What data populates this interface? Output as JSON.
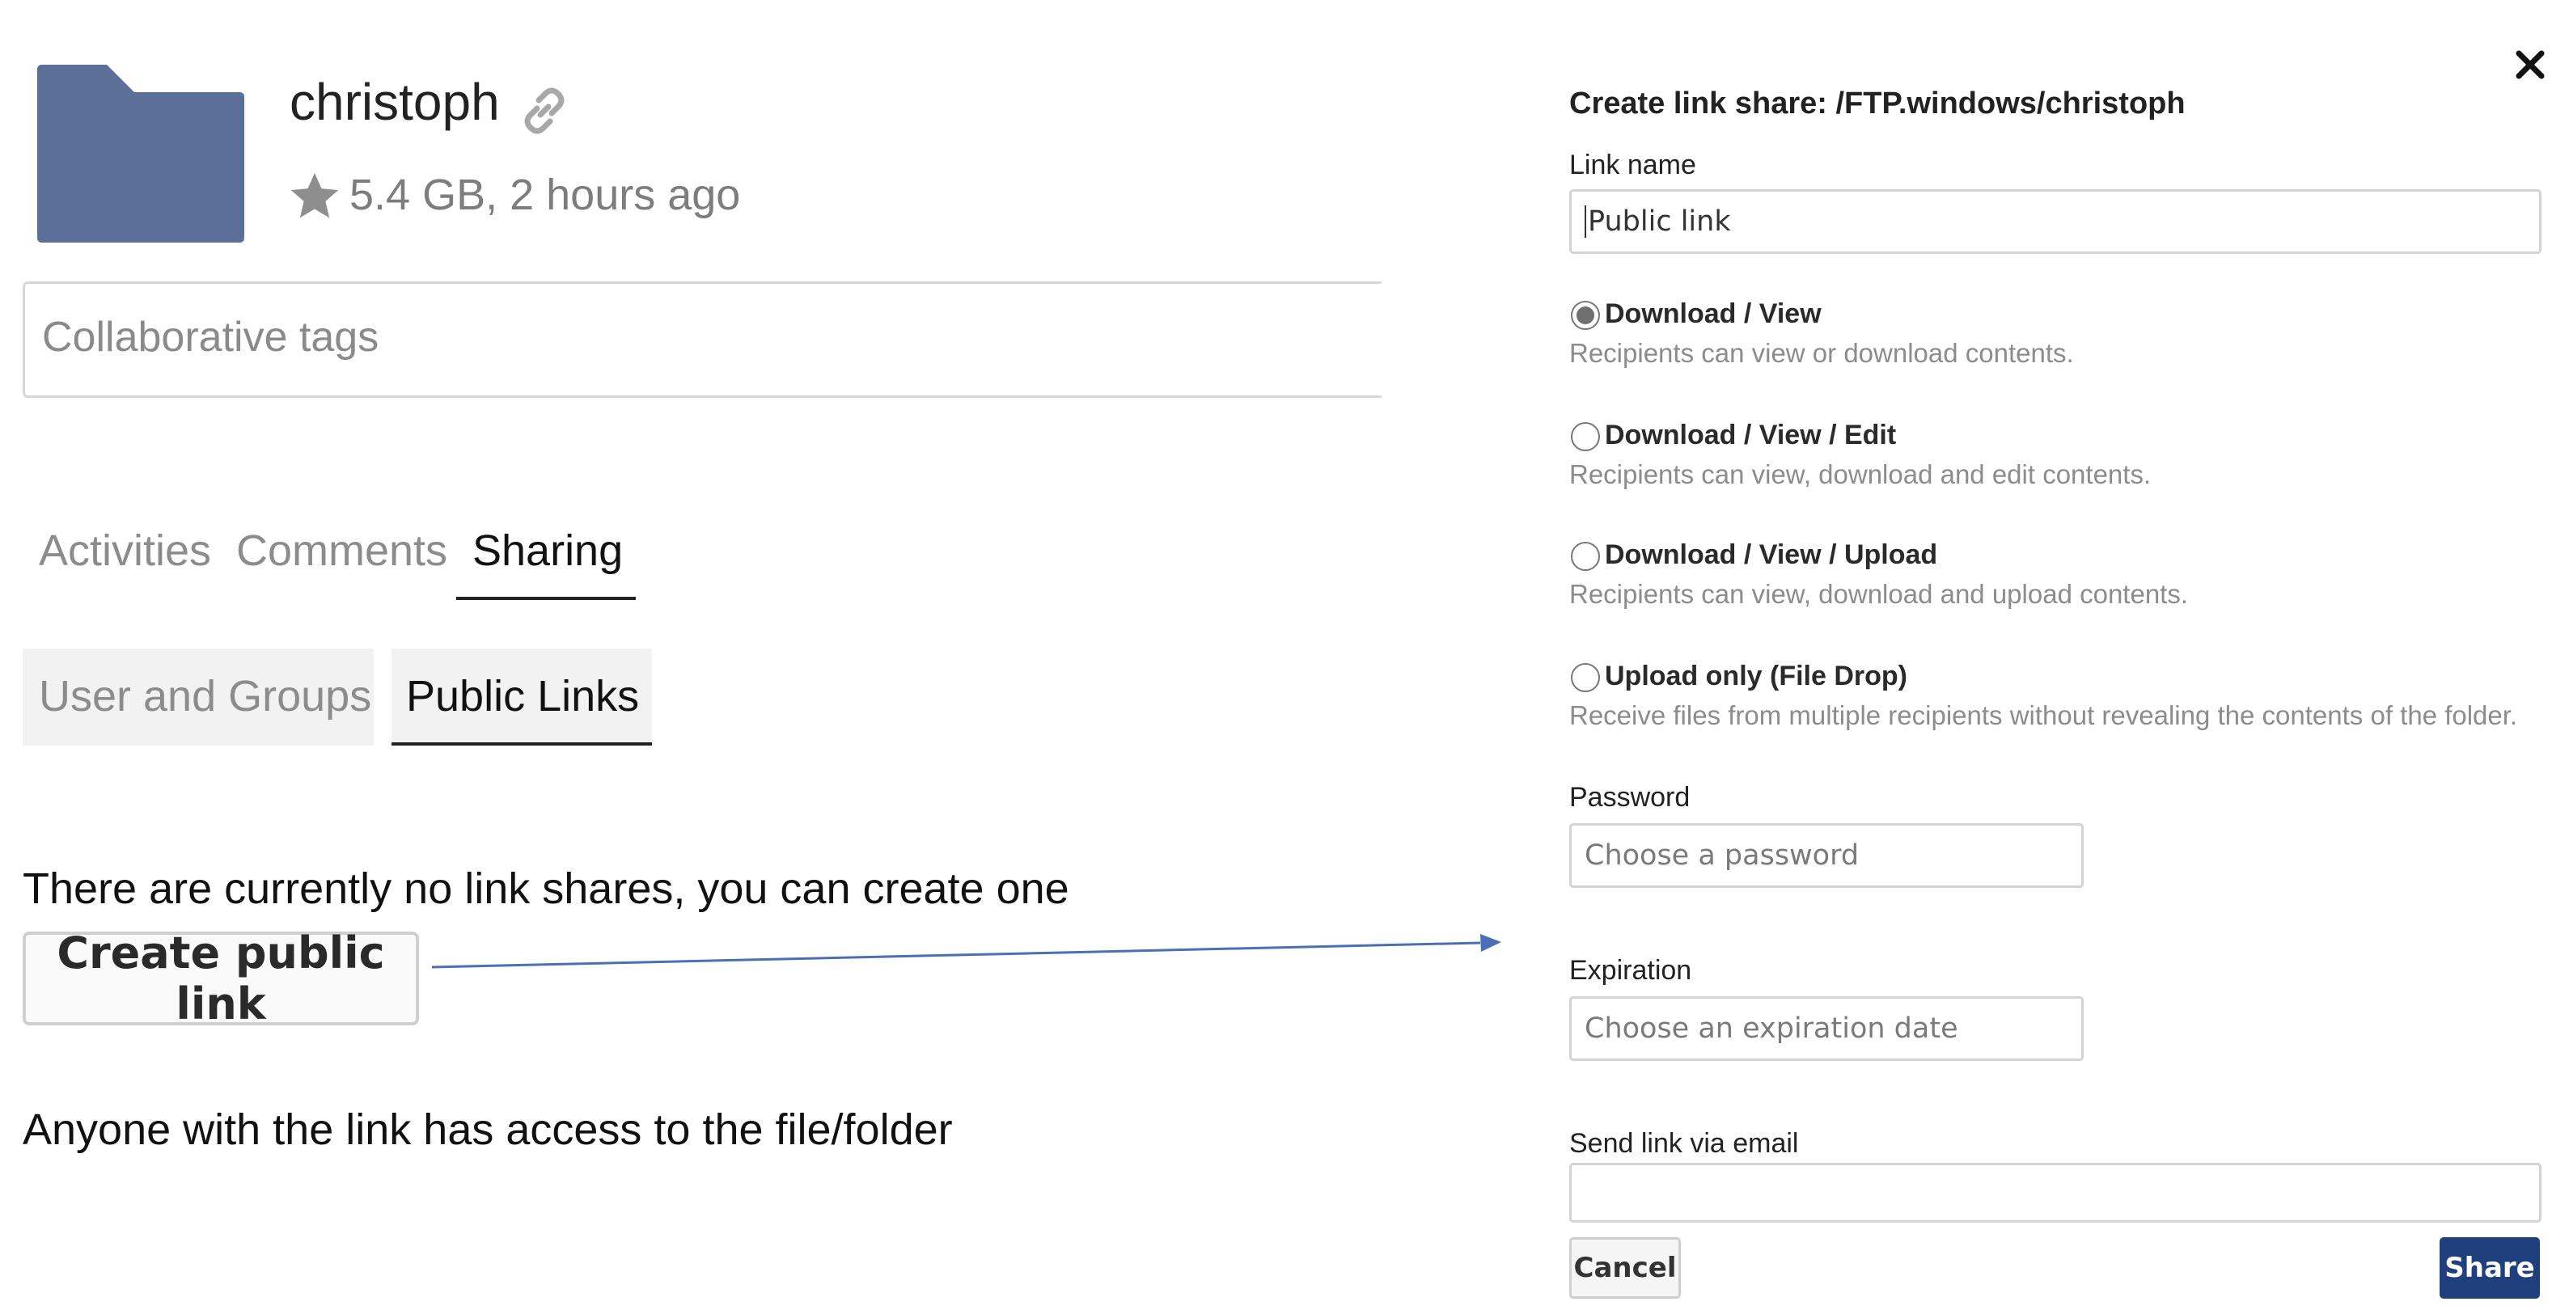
{
  "colors": {
    "folder": "#5b6f99",
    "arrow": "#4a6fb5",
    "share_button": "#1f3f7d"
  },
  "file": {
    "icon": "folder-icon",
    "name": "christoph",
    "meta": "5.4 GB, 2 hours ago"
  },
  "tags": {
    "placeholder": "Collaborative tags"
  },
  "tabs": [
    {
      "label": "Activities",
      "active": false
    },
    {
      "label": "Comments",
      "active": false
    },
    {
      "label": "Sharing",
      "active": true
    }
  ],
  "subtabs": [
    {
      "label": "User and Groups",
      "active": false
    },
    {
      "label": "Public Links",
      "active": true
    }
  ],
  "links_panel": {
    "empty_text": "There are currently no link shares, you can create one",
    "create_label": "Create public link",
    "note": "Anyone with the link has access to the file/folder"
  },
  "dialog": {
    "title": "Create link share: /FTP.windows/christoph",
    "link_name_label": "Link name",
    "link_name_value": "Public link",
    "options": [
      {
        "title": "Download / View",
        "desc": "Recipients can view or download contents.",
        "checked": true
      },
      {
        "title": "Download / View / Edit",
        "desc": "Recipients can view, download and edit contents.",
        "checked": false
      },
      {
        "title": "Download / View / Upload",
        "desc": "Recipients can view, download and upload contents.",
        "checked": false
      },
      {
        "title": "Upload only (File Drop)",
        "desc": "Receive files from multiple recipients without revealing the contents of the folder.",
        "checked": false
      }
    ],
    "password_label": "Password",
    "password_placeholder": "Choose a password",
    "expiration_label": "Expiration",
    "expiration_placeholder": "Choose an expiration date",
    "email_label": "Send link via email",
    "email_value": "",
    "cancel_label": "Cancel",
    "share_label": "Share"
  }
}
